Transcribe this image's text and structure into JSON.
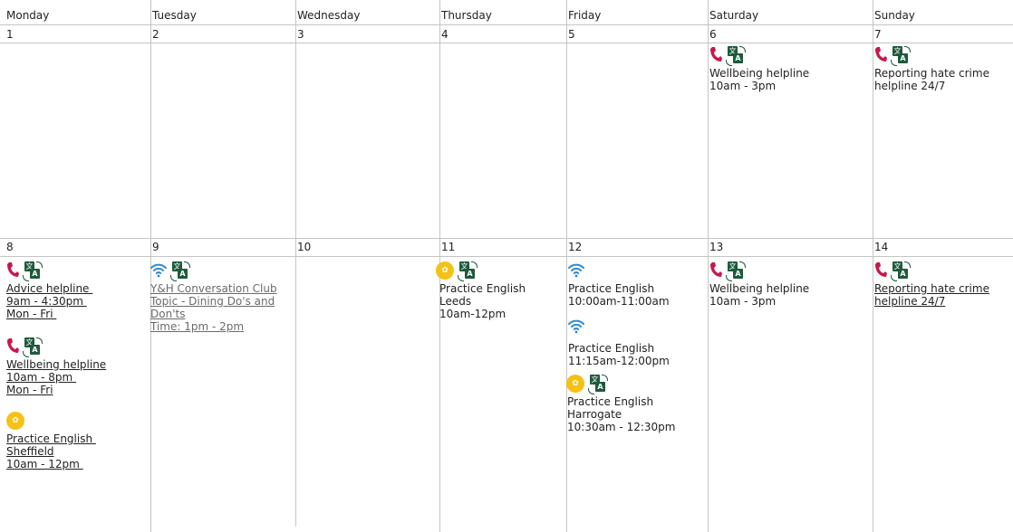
{
  "days": [
    "Monday",
    "Tuesday",
    "Wednesday",
    "Thursday",
    "Friday",
    "Saturday",
    "Sunday"
  ],
  "week1": [
    "1",
    "2",
    "3",
    "4",
    "5",
    "6",
    "7"
  ],
  "week2": [
    "8",
    "9",
    "10",
    "11",
    "12",
    "13",
    "14"
  ],
  "events": {
    "sat6": {
      "lines": [
        "Wellbeing helpline",
        "10am - 3pm"
      ]
    },
    "sun7": {
      "lines": [
        "Reporting hate crime",
        "helpline 24/7"
      ]
    },
    "mon8a": {
      "lines": [
        "Advice helpline ",
        "9am - 4:30pm ",
        "Mon - Fri "
      ]
    },
    "mon8b": {
      "lines": [
        "Wellbeing helpline",
        "10am - 8pm ",
        "Mon - Fri"
      ]
    },
    "mon8c": {
      "lines": [
        "Practice English ",
        "Sheffield",
        "10am - 12pm "
      ]
    },
    "tue9": {
      "lines": [
        "Y&H Conversation Club",
        "Topic - Dining Do's and",
        "Don'ts",
        "Time: 1pm - 2pm"
      ]
    },
    "thu11": {
      "lines": [
        "Practice English",
        "Leeds",
        "10am-12pm"
      ]
    },
    "fri12a": {
      "lines": [
        "Practice English",
        "10:00am-11:00am"
      ]
    },
    "fri12b": {
      "lines": [
        "Practice English",
        "11:15am-12:00pm"
      ]
    },
    "fri12c": {
      "lines": [
        "Practice English",
        "Harrogate",
        "10:30am - 12:30pm"
      ]
    },
    "sat13": {
      "lines": [
        "Wellbeing helpline",
        "10am - 3pm"
      ]
    },
    "sun14": {
      "lines": [
        "Reporting hate crime",
        "helpline 24/7"
      ]
    }
  },
  "icons": {
    "phone": "phone-icon",
    "translate": "translate-icon",
    "wifi": "wifi-icon",
    "in_person": "in-person-icon"
  },
  "colors": {
    "phone": "#c8174b",
    "translate": "#1e5a3c",
    "wifi": "#2b8bd6",
    "in_person": "#f4c216",
    "grid": "#c4c4c4"
  }
}
